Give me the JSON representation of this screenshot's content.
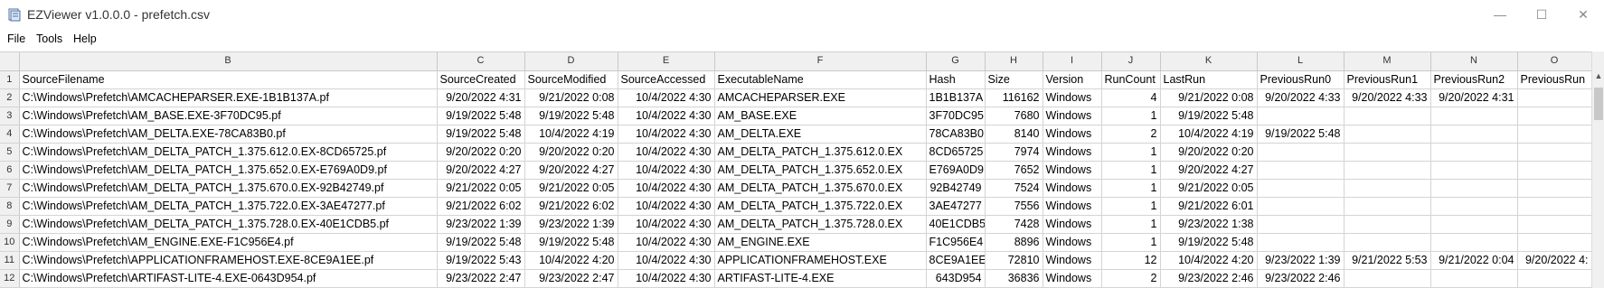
{
  "window": {
    "title": "EZViewer v1.0.0.0 - prefetch.csv",
    "min_glyph": "—",
    "max_glyph": "☐",
    "close_glyph": "✕"
  },
  "menu": [
    "File",
    "Tools",
    "Help"
  ],
  "scroll_up_glyph": "▲",
  "grid": {
    "column_letters": [
      "B",
      "C",
      "D",
      "E",
      "F",
      "G",
      "H",
      "I",
      "J",
      "K",
      "L",
      "M",
      "N",
      "O"
    ],
    "rows": [
      {
        "n": "1",
        "cells": [
          "SourceFilename",
          "SourceCreated",
          "SourceModified",
          "SourceAccessed",
          "ExecutableName",
          "Hash",
          "Size",
          "Version",
          "RunCount",
          "LastRun",
          "PreviousRun0",
          "PreviousRun1",
          "PreviousRun2",
          "PreviousRun"
        ]
      },
      {
        "n": "2",
        "cells": [
          "C:\\Windows\\Prefetch\\AMCACHEPARSER.EXE-1B1B137A.pf",
          "9/20/2022 4:31",
          "9/21/2022 0:08",
          "10/4/2022 4:30",
          "AMCACHEPARSER.EXE",
          "1B1B137A",
          "116162",
          "Windows",
          "4",
          "9/21/2022 0:08",
          "9/20/2022 4:33",
          "9/20/2022 4:33",
          "9/20/2022 4:31",
          ""
        ]
      },
      {
        "n": "3",
        "cells": [
          "C:\\Windows\\Prefetch\\AM_BASE.EXE-3F70DC95.pf",
          "9/19/2022 5:48",
          "9/19/2022 5:48",
          "10/4/2022 4:30",
          "AM_BASE.EXE",
          "3F70DC95",
          "7680",
          "Windows",
          "1",
          "9/19/2022 5:48",
          "",
          "",
          "",
          ""
        ]
      },
      {
        "n": "4",
        "cells": [
          "C:\\Windows\\Prefetch\\AM_DELTA.EXE-78CA83B0.pf",
          "9/19/2022 5:48",
          "10/4/2022 4:19",
          "10/4/2022 4:30",
          "AM_DELTA.EXE",
          "78CA83B0",
          "8140",
          "Windows",
          "2",
          "10/4/2022 4:19",
          "9/19/2022 5:48",
          "",
          "",
          ""
        ]
      },
      {
        "n": "5",
        "cells": [
          "C:\\Windows\\Prefetch\\AM_DELTA_PATCH_1.375.612.0.EX-8CD65725.pf",
          "9/20/2022 0:20",
          "9/20/2022 0:20",
          "10/4/2022 4:30",
          "AM_DELTA_PATCH_1.375.612.0.EX",
          "8CD65725",
          "7974",
          "Windows",
          "1",
          "9/20/2022 0:20",
          "",
          "",
          "",
          ""
        ]
      },
      {
        "n": "6",
        "cells": [
          "C:\\Windows\\Prefetch\\AM_DELTA_PATCH_1.375.652.0.EX-E769A0D9.pf",
          "9/20/2022 4:27",
          "9/20/2022 4:27",
          "10/4/2022 4:30",
          "AM_DELTA_PATCH_1.375.652.0.EX",
          "E769A0D9",
          "7652",
          "Windows",
          "1",
          "9/20/2022 4:27",
          "",
          "",
          "",
          ""
        ]
      },
      {
        "n": "7",
        "cells": [
          "C:\\Windows\\Prefetch\\AM_DELTA_PATCH_1.375.670.0.EX-92B42749.pf",
          "9/21/2022 0:05",
          "9/21/2022 0:05",
          "10/4/2022 4:30",
          "AM_DELTA_PATCH_1.375.670.0.EX",
          "92B42749",
          "7524",
          "Windows",
          "1",
          "9/21/2022 0:05",
          "",
          "",
          "",
          ""
        ]
      },
      {
        "n": "8",
        "cells": [
          "C:\\Windows\\Prefetch\\AM_DELTA_PATCH_1.375.722.0.EX-3AE47277.pf",
          "9/21/2022 6:02",
          "9/21/2022 6:02",
          "10/4/2022 4:30",
          "AM_DELTA_PATCH_1.375.722.0.EX",
          "3AE47277",
          "7556",
          "Windows",
          "1",
          "9/21/2022 6:01",
          "",
          "",
          "",
          ""
        ]
      },
      {
        "n": "9",
        "cells": [
          "C:\\Windows\\Prefetch\\AM_DELTA_PATCH_1.375.728.0.EX-40E1CDB5.pf",
          "9/23/2022 1:39",
          "9/23/2022 1:39",
          "10/4/2022 4:30",
          "AM_DELTA_PATCH_1.375.728.0.EX",
          "40E1CDB5",
          "7428",
          "Windows",
          "1",
          "9/23/2022 1:38",
          "",
          "",
          "",
          ""
        ]
      },
      {
        "n": "10",
        "cells": [
          "C:\\Windows\\Prefetch\\AM_ENGINE.EXE-F1C956E4.pf",
          "9/19/2022 5:48",
          "9/19/2022 5:48",
          "10/4/2022 4:30",
          "AM_ENGINE.EXE",
          "F1C956E4",
          "8896",
          "Windows",
          "1",
          "9/19/2022 5:48",
          "",
          "",
          "",
          ""
        ]
      },
      {
        "n": "11",
        "cells": [
          "C:\\Windows\\Prefetch\\APPLICATIONFRAMEHOST.EXE-8CE9A1EE.pf",
          "9/19/2022 5:43",
          "10/4/2022 4:20",
          "10/4/2022 4:30",
          "APPLICATIONFRAMEHOST.EXE",
          "8CE9A1EE",
          "72810",
          "Windows",
          "12",
          "10/4/2022 4:20",
          "9/23/2022 1:39",
          "9/21/2022 5:53",
          "9/21/2022 0:04",
          "9/20/2022 4:"
        ]
      },
      {
        "n": "12",
        "cells": [
          "C:\\Windows\\Prefetch\\ARTIFAST-LITE-4.EXE-0643D954.pf",
          "9/23/2022 2:47",
          "9/23/2022 2:47",
          "10/4/2022 4:30",
          "ARTIFAST-LITE-4.EXE",
          "643D954",
          "36836",
          "Windows",
          "2",
          "9/23/2022 2:46",
          "9/23/2022 2:46",
          "",
          "",
          ""
        ]
      }
    ]
  }
}
